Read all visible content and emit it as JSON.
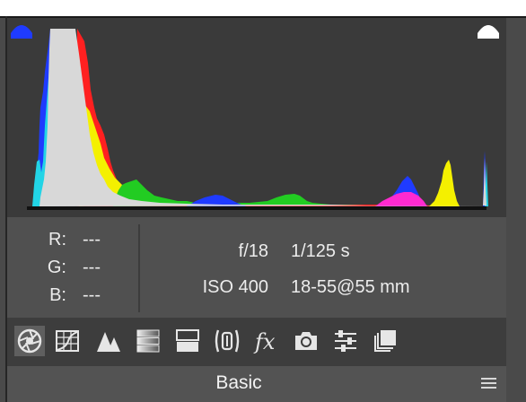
{
  "histogram": {
    "shadow_clip_icon": "shadow-clipping-warning-icon",
    "highlight_clip_icon": "highlight-clipping-warning-icon",
    "colors": {
      "background": "#3a3a3a",
      "luminance": "#d8d8d8",
      "red": "#ff2020",
      "green": "#22cc22",
      "blue": "#1f3bff",
      "cyan": "#22d4e6",
      "magenta": "#ff2ad0",
      "yellow": "#f4f000",
      "baseline": "#111111"
    }
  },
  "readout": {
    "r_label": "R:",
    "g_label": "G:",
    "b_label": "B:",
    "r_value": "---",
    "g_value": "---",
    "b_value": "---"
  },
  "exif": {
    "aperture": "f/18",
    "shutter": "1/125 s",
    "iso": "ISO 400",
    "lens": "18-55@55 mm"
  },
  "toolbar": {
    "tools": [
      {
        "icon": "aperture-icon",
        "active": true
      },
      {
        "icon": "tone-curve-icon"
      },
      {
        "icon": "detail-icon"
      },
      {
        "icon": "hsl-grayscale-icon"
      },
      {
        "icon": "split-toning-icon"
      },
      {
        "icon": "lens-corrections-icon"
      },
      {
        "icon": "fx-icon"
      },
      {
        "icon": "camera-calibration-icon"
      },
      {
        "icon": "presets-sliders-icon"
      },
      {
        "icon": "snapshots-icon"
      }
    ]
  },
  "section": {
    "title": "Basic",
    "menu_icon": "panel-menu-icon"
  }
}
